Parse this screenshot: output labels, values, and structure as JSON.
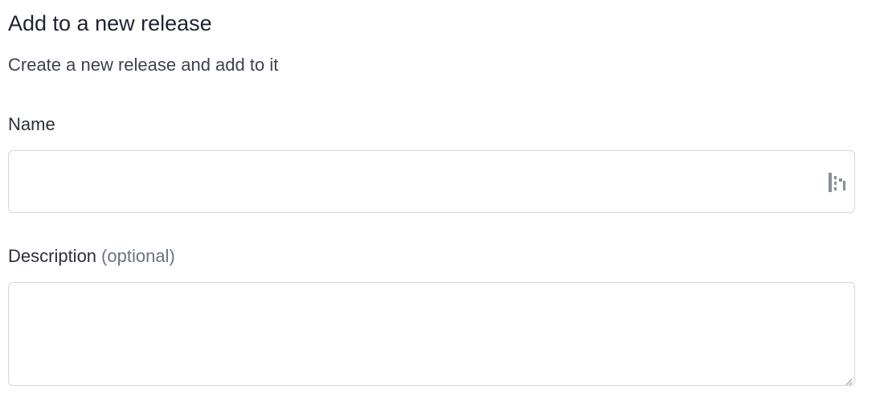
{
  "dialog": {
    "title": "Add to a new release",
    "subtitle": "Create a new release and add to it"
  },
  "form": {
    "name": {
      "label": "Name",
      "value": "",
      "placeholder": ""
    },
    "description": {
      "label": "Description",
      "optional_label": "(optional)",
      "value": "",
      "placeholder": ""
    }
  },
  "icons": {
    "name_field_icon": "password-manager-icon",
    "description_resize": "resize-handle-icon"
  },
  "colors": {
    "text_primary": "#1f2330",
    "text_muted": "#6b7280",
    "border": "#d3d6dc",
    "icon": "#8a8f98"
  }
}
